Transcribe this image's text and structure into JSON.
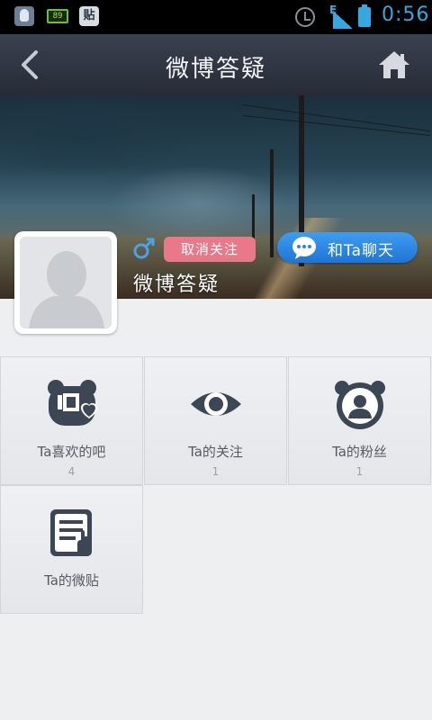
{
  "status_bar": {
    "battery_small_label": "89",
    "tieba_label": "贴",
    "network_label": "E",
    "time": "0:56"
  },
  "header": {
    "title": "微博答疑"
  },
  "profile": {
    "unfollow_label": "取消关注",
    "chat_label": "和Ta聊天",
    "username": "微博答疑"
  },
  "grid": [
    {
      "label": "Ta喜欢的吧",
      "count": "4",
      "icon": "bar-heart-icon"
    },
    {
      "label": "Ta的关注",
      "count": "1",
      "icon": "eye-icon"
    },
    {
      "label": "Ta的粉丝",
      "count": "1",
      "icon": "fans-icon"
    },
    {
      "label": "Ta的微贴",
      "count": "",
      "icon": "post-document-icon"
    }
  ],
  "colors": {
    "accent_blue": "#2a86e2",
    "unfollow_pink": "#e8788a",
    "icon_dark": "#3c4654",
    "status_blue": "#35a8e0"
  }
}
